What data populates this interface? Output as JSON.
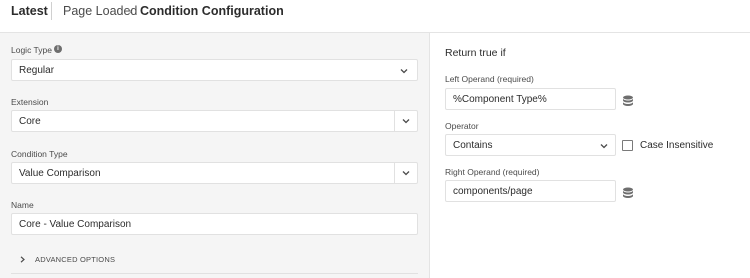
{
  "header": {
    "latest": "Latest",
    "breadcrumb_parent": "Page Loaded",
    "separator": "›",
    "breadcrumb_current": "Condition Configuration"
  },
  "left": {
    "logic_type": {
      "label": "Logic Type",
      "value": "Regular",
      "info_icon": "info-icon"
    },
    "extension": {
      "label": "Extension",
      "value": "Core"
    },
    "condition_type": {
      "label": "Condition Type",
      "value": "Value Comparison"
    },
    "name": {
      "label": "Name",
      "value": "Core - Value Comparison"
    },
    "advanced": {
      "label": "ADVANCED OPTIONS"
    }
  },
  "right": {
    "title": "Return true if",
    "left_operand": {
      "label": "Left Operand (required)",
      "value": "%Component Type%",
      "icon": "data-element-icon"
    },
    "operator": {
      "label": "Operator",
      "value": "Contains"
    },
    "case_insensitive": {
      "label": "Case Insensitive",
      "checked": false
    },
    "right_operand": {
      "label": "Right Operand (required)",
      "value": "components/page",
      "icon": "data-element-icon"
    }
  },
  "colors": {
    "panel_bg": "#f5f5f5",
    "border": "#e1e1e1",
    "text": "#2c2c2c"
  }
}
